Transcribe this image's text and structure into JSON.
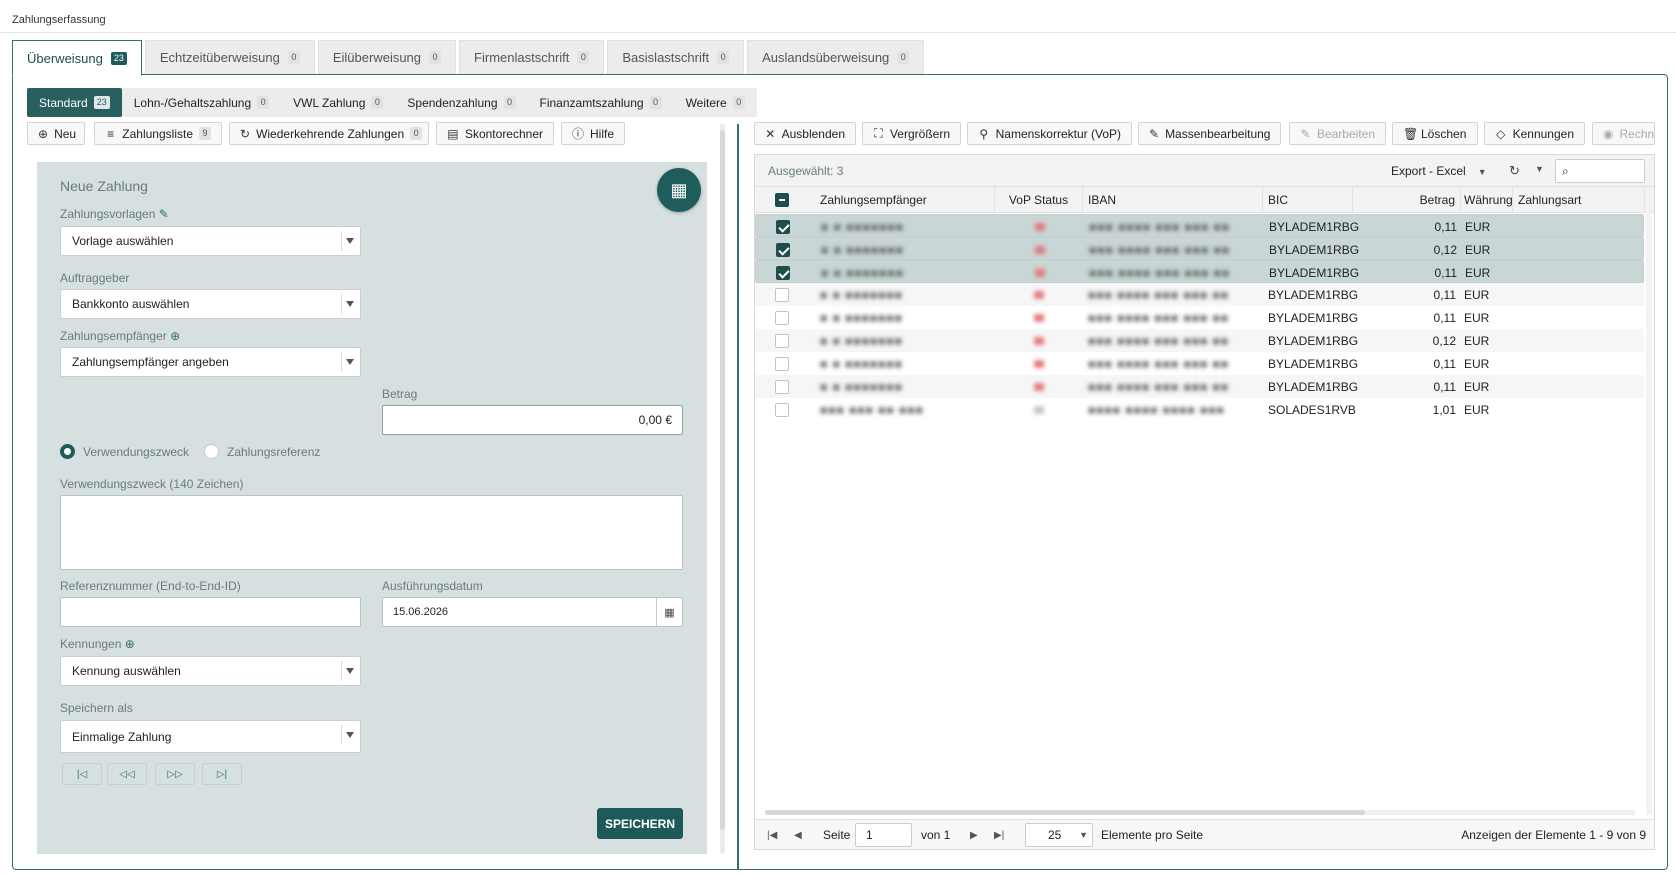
{
  "page_title": "Zahlungserfassung",
  "main_tabs": [
    {
      "label": "Überweisung",
      "count": "23"
    },
    {
      "label": "Echtzeitüberweisung",
      "count": "0"
    },
    {
      "label": "Eilüberweisung",
      "count": "0"
    },
    {
      "label": "Firmenlastschrift",
      "count": "0"
    },
    {
      "label": "Basislastschrift",
      "count": "0"
    },
    {
      "label": "Auslandsüberweisung",
      "count": "0"
    }
  ],
  "sub_tabs": [
    {
      "label": "Standard",
      "count": "23"
    },
    {
      "label": "Lohn-/Gehaltszahlung",
      "count": "0"
    },
    {
      "label": "VWL Zahlung",
      "count": "0"
    },
    {
      "label": "Spendenzahlung",
      "count": "0"
    },
    {
      "label": "Finanzamtszahlung",
      "count": "0"
    },
    {
      "label": "Weitere",
      "count": "0"
    }
  ],
  "left_toolbar": {
    "new": "Neu",
    "list": "Zahlungsliste",
    "list_count": "9",
    "recurring": "Wiederkehrende Zahlungen",
    "recurring_count": "0",
    "discount": "Skontorechner",
    "help": "Hilfe"
  },
  "form": {
    "title": "Neue Zahlung",
    "templates_label": "Zahlungsvorlagen",
    "templates_value": "Vorlage auswählen",
    "payer_label": "Auftraggeber",
    "payer_value": "Bankkonto auswählen",
    "payee_label": "Zahlungsempfänger",
    "payee_value": "Zahlungsempfänger angeben",
    "amount_label": "Betrag",
    "amount_value": "0,00 €",
    "radio_purpose": "Verwendungszweck",
    "radio_reference": "Zahlungsreferenz",
    "purpose_label": "Verwendungszweck (140 Zeichen)",
    "e2e_label": "Referenznummer (End-to-End-ID)",
    "date_label": "Ausführungsdatum",
    "date_value": "15.06.2026",
    "ids_label": "Kennungen",
    "ids_value": "Kennung auswählen",
    "save_as_label": "Speichern als",
    "save_as_value": "Einmalige Zahlung",
    "save_button": "SPEICHERN"
  },
  "right_toolbar": {
    "hide": "Ausblenden",
    "enlarge": "Vergrößern",
    "name_correction": "Namenskorrektur (VoP)",
    "mass_edit": "Massenbearbeitung",
    "edit": "Bearbeiten",
    "delete": "Löschen",
    "ids": "Kennungen",
    "invoice": "Rechn"
  },
  "grid": {
    "selected": "Ausgewählt: 3",
    "export": "Export - Excel",
    "columns": {
      "payee": "Zahlungsempfänger",
      "vop": "VoP Status",
      "iban": "IBAN",
      "bic": "BIC",
      "amount": "Betrag",
      "currency": "Währung",
      "type": "Zahlungsart"
    },
    "rows": [
      {
        "checked": true,
        "payee": "■ ■ ■■■■■■■",
        "iban": "■■■ ■■■■ ■■■ ■■■ ■■",
        "bic": "BYLADEM1RBG",
        "amount": "0,11",
        "currency": "EUR",
        "vop": "red"
      },
      {
        "checked": true,
        "payee": "■ ■ ■■■■■■■",
        "iban": "■■■ ■■■■ ■■■ ■■■ ■■",
        "bic": "BYLADEM1RBG",
        "amount": "0,12",
        "currency": "EUR",
        "vop": "red"
      },
      {
        "checked": true,
        "payee": "■ ■ ■■■■■■■",
        "iban": "■■■ ■■■■ ■■■ ■■■ ■■",
        "bic": "BYLADEM1RBG",
        "amount": "0,11",
        "currency": "EUR",
        "vop": "red"
      },
      {
        "checked": false,
        "payee": "■ ■ ■■■■■■■",
        "iban": "■■■ ■■■■ ■■■ ■■■ ■■",
        "bic": "BYLADEM1RBG",
        "amount": "0,11",
        "currency": "EUR",
        "vop": "red"
      },
      {
        "checked": false,
        "payee": "■ ■ ■■■■■■■",
        "iban": "■■■ ■■■■ ■■■ ■■■ ■■",
        "bic": "BYLADEM1RBG",
        "amount": "0,11",
        "currency": "EUR",
        "vop": "red"
      },
      {
        "checked": false,
        "payee": "■ ■ ■■■■■■■",
        "iban": "■■■ ■■■■ ■■■ ■■■ ■■",
        "bic": "BYLADEM1RBG",
        "amount": "0,12",
        "currency": "EUR",
        "vop": "red"
      },
      {
        "checked": false,
        "payee": "■ ■ ■■■■■■■",
        "iban": "■■■ ■■■■ ■■■ ■■■ ■■",
        "bic": "BYLADEM1RBG",
        "amount": "0,11",
        "currency": "EUR",
        "vop": "red"
      },
      {
        "checked": false,
        "payee": "■ ■ ■■■■■■■",
        "iban": "■■■ ■■■■ ■■■ ■■■ ■■",
        "bic": "BYLADEM1RBG",
        "amount": "0,11",
        "currency": "EUR",
        "vop": "red"
      },
      {
        "checked": false,
        "payee": "■■■ ■■■ ■■ ■■■",
        "iban": "■■■■ ■■■■ ■■■■ ■■■",
        "bic": "SOLADES1RVB",
        "amount": "1,01",
        "currency": "EUR",
        "vop": "grey"
      }
    ],
    "pager": {
      "page_label": "Seite",
      "page_value": "1",
      "of_label": "von 1",
      "page_size": "25",
      "per_page_label": "Elemente pro Seite",
      "summary": "Anzeigen der Elemente 1 - 9 von 9"
    }
  },
  "colors": {
    "accent": "#1f5b5b",
    "panel": "#d6e0e0",
    "selected_row": "#c9d6d6"
  }
}
